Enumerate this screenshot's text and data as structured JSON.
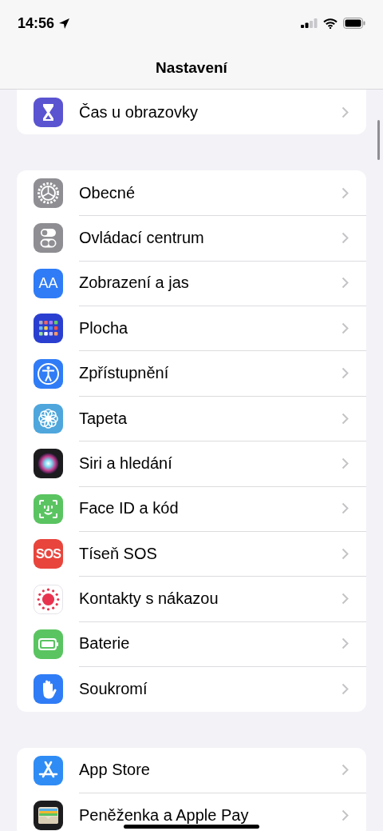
{
  "status_bar": {
    "time": "14:56"
  },
  "nav_bar": {
    "title": "Nastavení"
  },
  "groups": [
    {
      "rows": [
        {
          "kind": "hourglass",
          "color": "#5a54d1",
          "label": "Čas u obrazovky"
        }
      ]
    },
    {
      "rows": [
        {
          "kind": "gear",
          "color": "#8e8e93",
          "label": "Obecné"
        },
        {
          "kind": "toggles",
          "color": "#8e8e93",
          "label": "Ovládací centrum"
        },
        {
          "kind": "textsize",
          "color": "#2f7cf6",
          "label": "Zobrazení a jas",
          "icon_text": "AA"
        },
        {
          "kind": "grid",
          "color": "#2a3fd0",
          "label": "Plocha"
        },
        {
          "kind": "accessibility",
          "color": "#2f7cf6",
          "label": "Zpřístupnění"
        },
        {
          "kind": "flower",
          "color": "#4ea6dc",
          "label": "Tapeta"
        },
        {
          "kind": "siri",
          "color": "#1c1c1e",
          "label": "Siri a hledání"
        },
        {
          "kind": "face",
          "color": "#5ac461",
          "label": "Face ID a kód"
        },
        {
          "kind": "sos",
          "color": "#e8453c",
          "label": "Tíseň SOS",
          "icon_text": "SOS"
        },
        {
          "kind": "exposure",
          "color": "#ffffff",
          "label": "Kontakty s nákazou"
        },
        {
          "kind": "battery",
          "color": "#5ac461",
          "label": "Baterie"
        },
        {
          "kind": "hand",
          "color": "#2f7cf6",
          "label": "Soukromí"
        }
      ]
    },
    {
      "rows": [
        {
          "kind": "appstore",
          "color": "#2f8cf5",
          "label": "App Store"
        },
        {
          "kind": "wallet",
          "color": "#1c1c1e",
          "label": "Peněženka a Apple Pay"
        }
      ]
    }
  ]
}
